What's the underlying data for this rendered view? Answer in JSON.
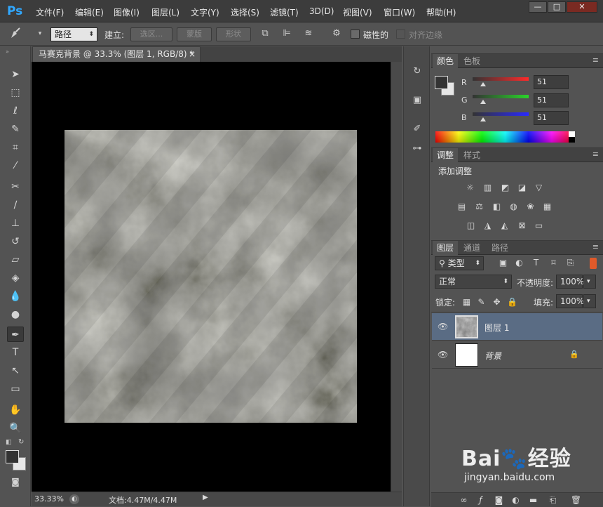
{
  "app": {
    "logo": "Ps"
  },
  "menu": [
    "文件(F)",
    "编辑(E)",
    "图像(I)",
    "图层(L)",
    "文字(Y)",
    "选择(S)",
    "滤镜(T)",
    "3D(D)",
    "视图(V)",
    "窗口(W)",
    "帮助(H)"
  ],
  "window_controls": {
    "minimize": "—",
    "maximize": "□",
    "close": "✕"
  },
  "options_bar": {
    "mode": "路径",
    "make_label": "建立:",
    "selection_btn": "选区...",
    "mask_btn": "蒙版",
    "shape_btn": "形状",
    "magnetic_label": "磁性的",
    "align_edges_label": "对齐边缘"
  },
  "document": {
    "tab_title": "马赛克背景 @ 33.3% (图层 1, RGB/8) *",
    "close": "×",
    "zoom": "33.33%",
    "doc_size": "文档:4.47M/4.47M"
  },
  "color_panel": {
    "tabs": [
      "颜色",
      "色板"
    ],
    "channels": [
      {
        "label": "R",
        "value": "51"
      },
      {
        "label": "G",
        "value": "51"
      },
      {
        "label": "B",
        "value": "51"
      }
    ],
    "fg_color": "#333333",
    "bg_color": "#e6e6e6"
  },
  "adjustments_panel": {
    "tabs": [
      "调整",
      "样式"
    ],
    "title": "添加调整",
    "icons": [
      [
        "brightness-icon",
        "levels-icon",
        "curves-icon",
        "exposure-icon",
        "vibrance-icon"
      ],
      [
        "hue-saturation-icon",
        "color-balance-icon",
        "black-white-icon",
        "photo-filter-icon",
        "channel-mixer-icon",
        "color-lookup-icon"
      ],
      [
        "invert-icon",
        "posterize-icon",
        "threshold-icon",
        "selective-color-icon",
        "gradient-map-icon"
      ]
    ]
  },
  "layers_panel": {
    "tabs": [
      "图层",
      "通道",
      "路径"
    ],
    "filter_kind": "类型",
    "blend_mode": "正常",
    "opacity_label": "不透明度:",
    "opacity": "100%",
    "lock_label": "锁定:",
    "fill_label": "填充:",
    "fill": "100%",
    "layers": [
      {
        "name": "图层 1",
        "selected": true,
        "locked": false
      },
      {
        "name": "背景",
        "selected": false,
        "locked": true
      }
    ]
  },
  "watermark": {
    "brand": "Bai",
    "brand2": "经验",
    "url": "jingyan.baidu.com"
  }
}
